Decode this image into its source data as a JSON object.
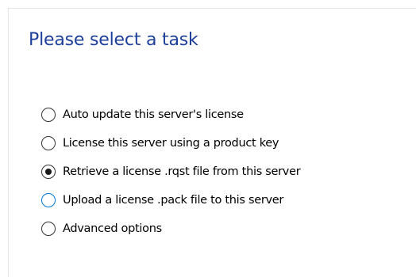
{
  "header": {
    "title": "Please select a task"
  },
  "options": [
    {
      "label": "Auto update this server's license",
      "selected": false
    },
    {
      "label": "License this server using a product key",
      "selected": false
    },
    {
      "label": "Retrieve a license .rqst file from this server",
      "selected": true
    },
    {
      "label": "Upload a license .pack file to this server",
      "selected": false,
      "focused": true
    },
    {
      "label": "Advanced options",
      "selected": false
    }
  ],
  "colors": {
    "title": "#1e3f9a",
    "focus_ring": "#0078d7",
    "radio_border": "#333333",
    "text": "#000000"
  }
}
